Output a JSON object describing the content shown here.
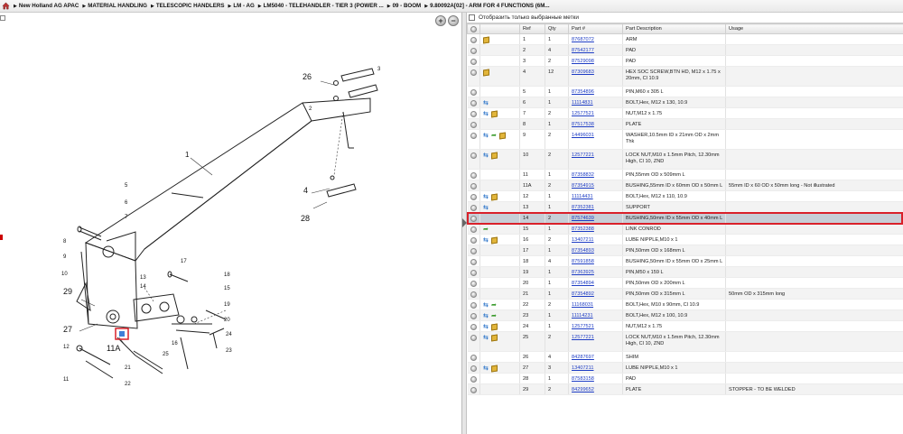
{
  "breadcrumb": [
    "New Holland AG APAC",
    "MATERIAL HANDLING",
    "TELESCOPIC HANDLERS",
    "LM - AG",
    "LM5040 - TELEHANDLER - TIER 3 (POWER ...",
    "09 - BOOM",
    "9.80092A[02] - ARM FOR 4 FUNCTIONS (6M..."
  ],
  "filter_label": "Отобразить только выбранные метки",
  "columns": {
    "ref": "Ref",
    "qty": "Qty",
    "part": "Part #",
    "desc": "Part Description",
    "usage": "Usage"
  },
  "zoom": {
    "in": "+",
    "out": "−"
  },
  "diagram_labels": {
    "l1": "1",
    "l4": "4",
    "l26": "26",
    "l28": "28",
    "l29": "29",
    "l27": "27",
    "l11a": "11A",
    "l5": "5",
    "l6": "6",
    "l7": "7",
    "l8": "8",
    "l9": "9",
    "l10": "10",
    "l3": "3",
    "l2": "2",
    "l12": "12",
    "l11": "11",
    "l13": "13",
    "l14": "14",
    "l15": "15",
    "l16": "16",
    "l17": "17",
    "l18": "18",
    "l19": "19",
    "l20": "20",
    "l21": "21",
    "l22": "22",
    "l23": "23",
    "l24": "24",
    "l25": "25"
  },
  "rows": [
    {
      "icons": [
        "circ",
        "box"
      ],
      "ref": "1",
      "qty": "1",
      "part": "87687072",
      "desc": "ARM",
      "usage": ""
    },
    {
      "icons": [
        "circ"
      ],
      "ref": "2",
      "qty": "4",
      "part": "87542177",
      "desc": "PAD",
      "usage": ""
    },
    {
      "icons": [
        "circ"
      ],
      "ref": "3",
      "qty": "2",
      "part": "87529098",
      "desc": "PAD",
      "usage": ""
    },
    {
      "icons": [
        "circ",
        "box"
      ],
      "ref": "4",
      "qty": "12",
      "part": "87309683",
      "desc": "HEX SOC SCREW,BTN HD, M12 x 1.75 x 20mm, Cl 10.9",
      "usage": "",
      "tall": true
    },
    {
      "icons": [
        "circ"
      ],
      "ref": "5",
      "qty": "1",
      "part": "87354896",
      "desc": "PIN,M60 x 305 L",
      "usage": ""
    },
    {
      "icons": [
        "circ",
        "swap"
      ],
      "ref": "6",
      "qty": "1",
      "part": "11114831",
      "desc": "BOLT,Hex, M12 x 130, 10.9",
      "usage": ""
    },
    {
      "icons": [
        "circ",
        "swap",
        "box"
      ],
      "ref": "7",
      "qty": "2",
      "part": "12577521",
      "desc": "NUT,M12 x 1.75",
      "usage": ""
    },
    {
      "icons": [
        "circ"
      ],
      "ref": "8",
      "qty": "1",
      "part": "87517538",
      "desc": "PLATE",
      "usage": ""
    },
    {
      "icons": [
        "circ",
        "swap",
        "arrow",
        "box"
      ],
      "ref": "9",
      "qty": "2",
      "part": "14496031",
      "desc": "WASHER,10.5mm ID x 21mm OD x 2mm Thk",
      "usage": "",
      "tall": true
    },
    {
      "icons": [
        "circ",
        "swap",
        "box"
      ],
      "ref": "10",
      "qty": "2",
      "part": "12577221",
      "desc": "LOCK NUT,M10 x 1.5mm Pitch, 12.30mm High, Cl 10, ZND",
      "usage": "",
      "tall": true
    },
    {
      "icons": [
        "circ"
      ],
      "ref": "11",
      "qty": "1",
      "part": "87358832",
      "desc": "PIN,55mm OD x 509mm L",
      "usage": ""
    },
    {
      "icons": [
        "circ"
      ],
      "ref": "11A",
      "qty": "2",
      "part": "87354915",
      "desc": "BUSHING,55mm ID x 60mm OD x 50mm L",
      "usage": "55mm ID x 60 OD x 50mm long - Not illustrated"
    },
    {
      "icons": [
        "circ",
        "swap",
        "box"
      ],
      "ref": "12",
      "qty": "1",
      "part": "11114431",
      "desc": "BOLT,Hex, M12 x 110, 10.9",
      "usage": ""
    },
    {
      "icons": [
        "circ",
        "swap"
      ],
      "ref": "13",
      "qty": "1",
      "part": "87352381",
      "desc": "SUPPORT",
      "usage": ""
    },
    {
      "icons": [
        "circ"
      ],
      "ref": "14",
      "qty": "2",
      "part": "87574639",
      "desc": "BUSHING,50mm ID x 55mm OD x 40mm L",
      "usage": "",
      "selected": true
    },
    {
      "icons": [
        "circ",
        "arrow"
      ],
      "ref": "15",
      "qty": "1",
      "part": "87352388",
      "desc": "LINK CONROD",
      "usage": ""
    },
    {
      "icons": [
        "circ",
        "swap",
        "box"
      ],
      "ref": "16",
      "qty": "2",
      "part": "13407211",
      "desc": "LUBE NIPPLE,M10 x 1",
      "usage": ""
    },
    {
      "icons": [
        "circ"
      ],
      "ref": "17",
      "qty": "1",
      "part": "87354893",
      "desc": "PIN,50mm OD x 168mm L",
      "usage": ""
    },
    {
      "icons": [
        "circ"
      ],
      "ref": "18",
      "qty": "4",
      "part": "87591858",
      "desc": "BUSHING,50mm ID x 55mm OD x 25mm L",
      "usage": ""
    },
    {
      "icons": [
        "circ"
      ],
      "ref": "19",
      "qty": "1",
      "part": "87363925",
      "desc": "PIN,M50 x 159 L",
      "usage": ""
    },
    {
      "icons": [
        "circ"
      ],
      "ref": "20",
      "qty": "1",
      "part": "87354894",
      "desc": "PIN,50mm OD x 200mm L",
      "usage": ""
    },
    {
      "icons": [
        "circ"
      ],
      "ref": "21",
      "qty": "1",
      "part": "87354892",
      "desc": "PIN,50mm OD x 315mm L",
      "usage": "50mm OD x 315mm long"
    },
    {
      "icons": [
        "circ",
        "swap",
        "arrow"
      ],
      "ref": "22",
      "qty": "2",
      "part": "11168031",
      "desc": "BOLT,Hex, M10 x 90mm, Cl 10.9",
      "usage": ""
    },
    {
      "icons": [
        "circ",
        "swap",
        "arrow"
      ],
      "ref": "23",
      "qty": "1",
      "part": "11114231",
      "desc": "BOLT,Hex, M12 x 100, 10.9",
      "usage": ""
    },
    {
      "icons": [
        "circ",
        "swap",
        "box"
      ],
      "ref": "24",
      "qty": "1",
      "part": "12577521",
      "desc": "NUT,M12 x 1.75",
      "usage": ""
    },
    {
      "icons": [
        "circ",
        "swap",
        "box"
      ],
      "ref": "25",
      "qty": "2",
      "part": "12577221",
      "desc": "LOCK NUT,M10 x 1.5mm Pitch, 12.30mm High, Cl 10, ZND",
      "usage": "",
      "tall": true
    },
    {
      "icons": [
        "circ"
      ],
      "ref": "26",
      "qty": "4",
      "part": "84287697",
      "desc": "SHIM",
      "usage": ""
    },
    {
      "icons": [
        "circ",
        "swap",
        "box"
      ],
      "ref": "27",
      "qty": "3",
      "part": "13407211",
      "desc": "LUBE NIPPLE,M10 x 1",
      "usage": ""
    },
    {
      "icons": [
        "circ"
      ],
      "ref": "28",
      "qty": "1",
      "part": "87583158",
      "desc": "PAD",
      "usage": ""
    },
    {
      "icons": [
        "circ"
      ],
      "ref": "29",
      "qty": "2",
      "part": "84299652",
      "desc": "PLATE",
      "usage": "STOPPER - TO BE WELDED"
    }
  ],
  "colors": {
    "link": "#1d3cc4",
    "selected_row": "#c7ced6",
    "selected_border": "#d9202a"
  }
}
